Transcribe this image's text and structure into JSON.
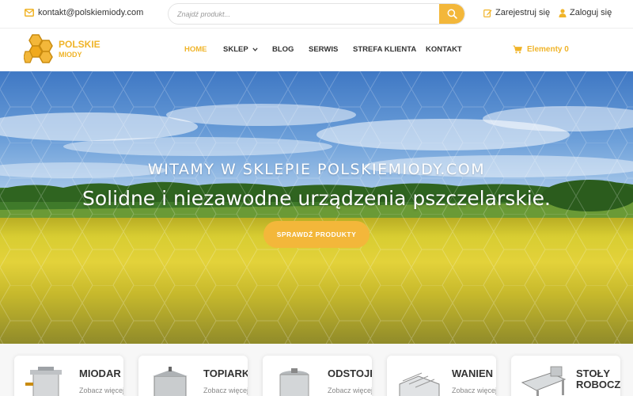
{
  "topbar": {
    "email": "kontakt@polskiemiody.com",
    "search_placeholder": "Znajdź produkt...",
    "register_label": "Zarejestruj się",
    "login_label": "Zaloguj się"
  },
  "logo": {
    "line1": "POLSKIE",
    "line2": "MIODY"
  },
  "nav": {
    "items": [
      {
        "label": "HOME",
        "active": true
      },
      {
        "label": "SKLEP",
        "dropdown": true
      },
      {
        "label": "BLOG"
      },
      {
        "label": "SERWIS"
      },
      {
        "label": "STREFA KLIENTA"
      },
      {
        "label": "KONTAKT"
      }
    ],
    "cart_label": "Elementy 0"
  },
  "hero": {
    "subtitle": "WITAMY W SKLEPIE POLSKIEMIODY.COM",
    "title": "Solidne i niezawodne urządzenia pszczelarskie.",
    "cta_label": "SPRAWDŹ PRODUKTY"
  },
  "categories": [
    {
      "name": "MIODAR",
      "more": "Zobacz więcej"
    },
    {
      "name": "TOPIARK",
      "more": "Zobacz więcej"
    },
    {
      "name": "ODSTOJI",
      "more": "Zobacz więcej"
    },
    {
      "name": "WANIEN",
      "more": "Zobacz więcej"
    },
    {
      "name": "STOŁY ROBOCZ",
      "name_line1": "STOŁY",
      "name_line2": "ROBOCZ"
    }
  ],
  "colors": {
    "accent": "#f3b73a",
    "text": "#333333"
  },
  "icons": {
    "email": "envelope-icon",
    "search": "search-icon",
    "register": "edit-icon",
    "login": "user-icon",
    "cart": "cart-icon",
    "dropdown": "chevron-down-icon"
  }
}
